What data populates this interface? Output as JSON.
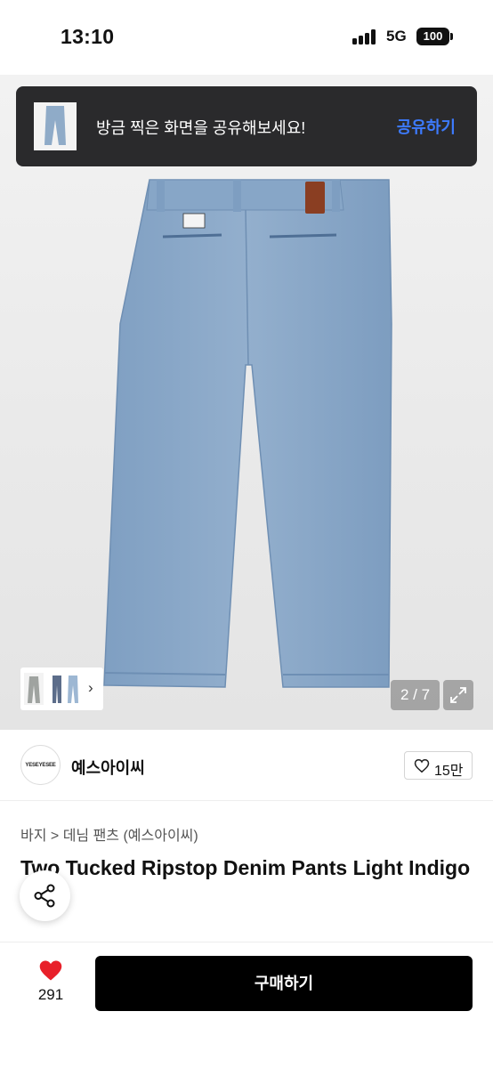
{
  "status_bar": {
    "time": "13:10",
    "network": "5G",
    "battery": "100"
  },
  "toast": {
    "message": "방금 찍은 화면을 공유해보세요!",
    "action_label": "공유하기"
  },
  "gallery": {
    "counter": "2 / 7"
  },
  "brand": {
    "logo_text": "YESEYESEE",
    "name": "예스아이씨",
    "likes": "15만"
  },
  "breadcrumb": {
    "category": "바지",
    "separator": ">",
    "subcategory": "데님 팬츠 (예스아이씨)"
  },
  "product": {
    "title": "Two Tucked Ripstop Denim Pants Light Indigo"
  },
  "bottom_bar": {
    "wish_count": "291",
    "buy_label": "구매하기"
  },
  "colors": {
    "accent_blue": "#3d7bff",
    "heart_red": "#e8202a",
    "buy_button": "#000000",
    "denim": "#8ba9c9"
  },
  "icons": [
    "signal-icon",
    "battery-icon",
    "chevron-right-icon",
    "expand-icon",
    "heart-outline-icon",
    "share-icon",
    "heart-filled-icon"
  ]
}
